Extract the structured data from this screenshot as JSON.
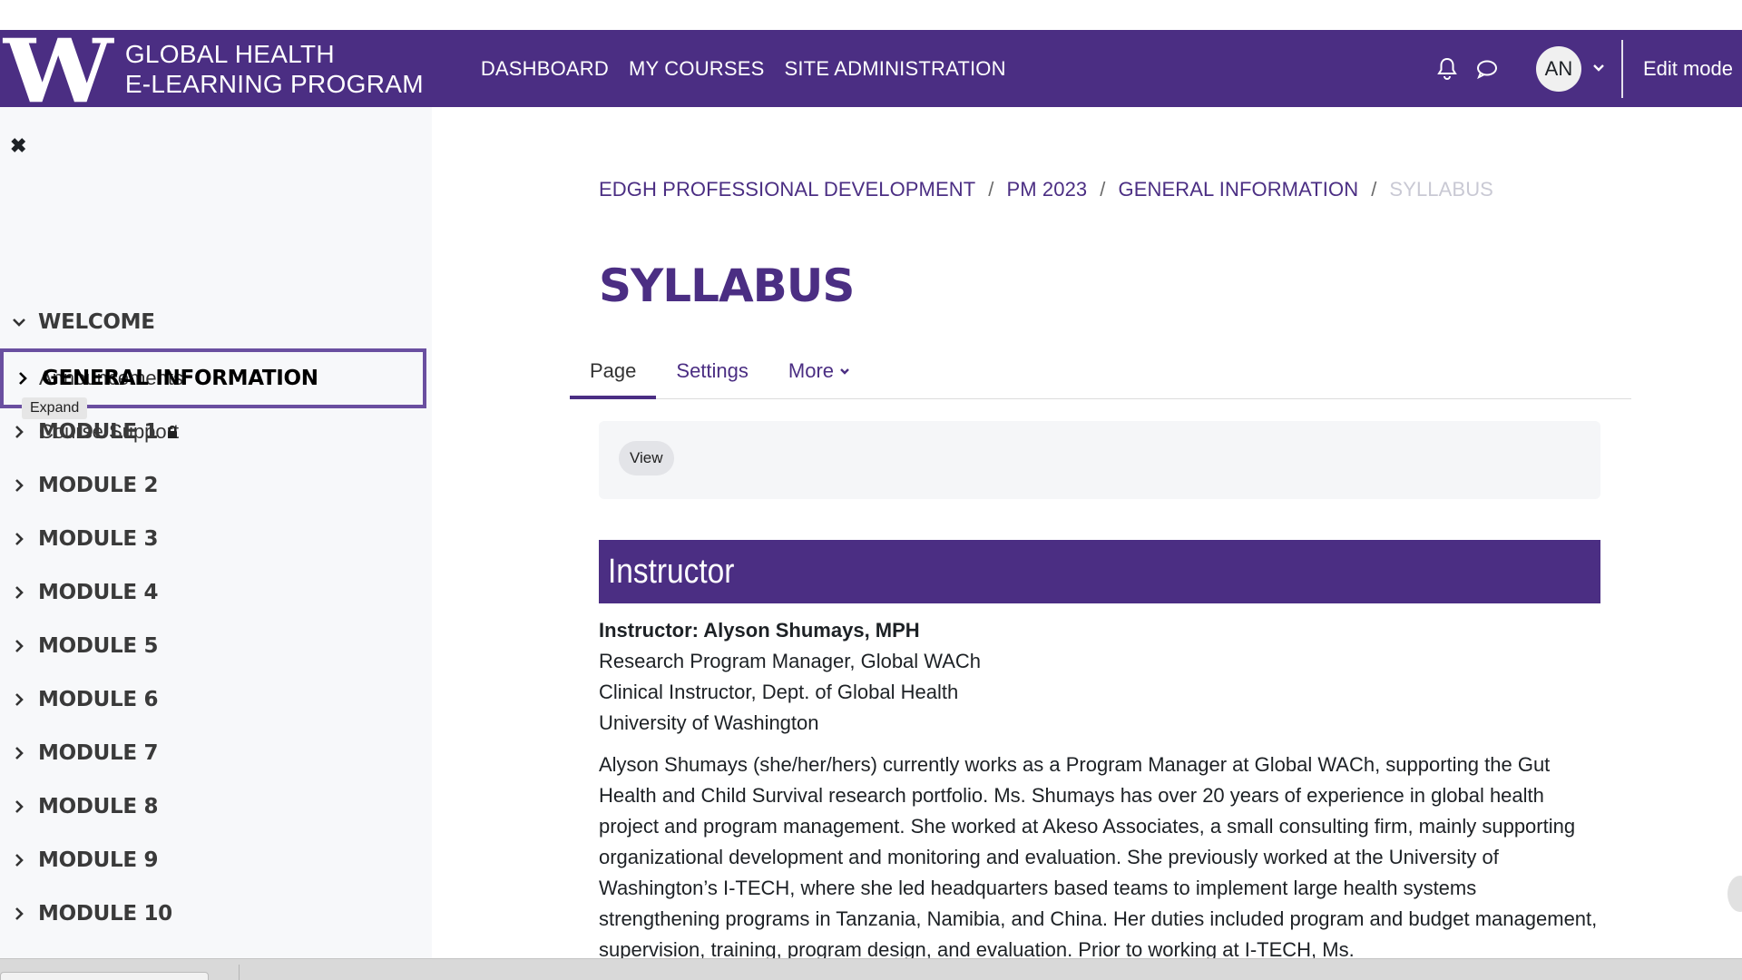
{
  "header": {
    "logo_text_line1": "GLOBAL HEALTH",
    "logo_text_line2": "E-LEARNING PROGRAM",
    "logo_letter": "W",
    "nav": [
      "DASHBOARD",
      "MY COURSES",
      "SITE ADMINISTRATION"
    ],
    "avatar_initials": "AN",
    "edit_mode_label": "Edit mode",
    "colors": {
      "brand": "#4b2e83"
    }
  },
  "sidebar": {
    "sections": [
      {
        "label": "WELCOME",
        "expanded": true,
        "items": [
          "Announcements",
          "Course Support"
        ]
      },
      {
        "label": "GENERAL INFORMATION",
        "expanded": false,
        "focused": true
      },
      {
        "label": "MODULE 1",
        "locked": true
      },
      {
        "label": "MODULE 2"
      },
      {
        "label": "MODULE 3"
      },
      {
        "label": "MODULE 4"
      },
      {
        "label": "MODULE 5"
      },
      {
        "label": "MODULE 6"
      },
      {
        "label": "MODULE 7"
      },
      {
        "label": "MODULE 8"
      },
      {
        "label": "MODULE 9"
      },
      {
        "label": "MODULE 10"
      }
    ],
    "tooltip": "Expand"
  },
  "main": {
    "breadcrumb": [
      "EDGH PROFESSIONAL DEVELOPMENT",
      "PM 2023",
      "GENERAL INFORMATION",
      "SYLLABUS"
    ],
    "page_title": "SYLLABUS",
    "tabs": [
      {
        "label": "Page",
        "active": true
      },
      {
        "label": "Settings"
      },
      {
        "label": "More"
      }
    ],
    "view_button": "View",
    "section_banner": "Instructor",
    "instructor_name": "Instructor: Alyson Shumays, MPH",
    "instructor_lines": [
      "Research Program Manager, Global WACh",
      "Clinical Instructor, Dept. of Global Health",
      "University of Washington"
    ],
    "bio": "Alyson Shumays (she/her/hers) currently works as a Program Manager at Global WACh, supporting the Gut Health and Child Survival research portfolio. Ms. Shumays has over 20 years of experience in global health project and program management. She worked at Akeso Associates, a small consulting firm, mainly supporting organizational development and monitoring and evaluation. She previously worked at the University of Washington’s I-TECH, where she led headquarters based teams to implement large health systems strengthening programs in Tanzania, Namibia, and China. Her duties included program and budget management, supervision, training, program design, and evaluation. Prior to working at I-TECH, Ms."
  }
}
